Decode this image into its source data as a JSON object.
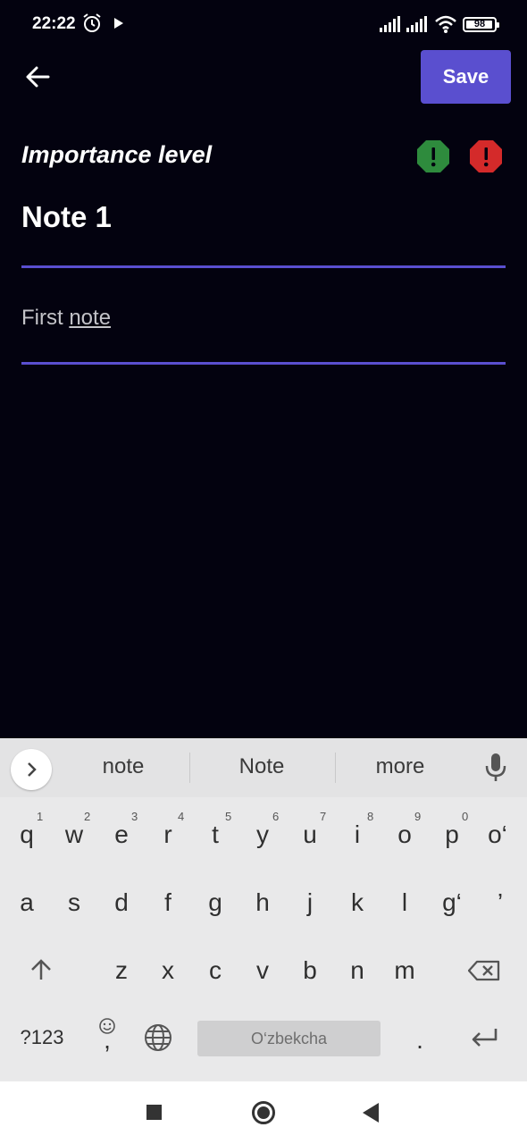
{
  "status_bar": {
    "time": "22:22",
    "battery_level": 98,
    "battery_text": "98",
    "icons": [
      "alarm-icon",
      "play-icon",
      "signal-icon",
      "signal-icon",
      "wifi-icon",
      "battery-icon"
    ]
  },
  "app_bar": {
    "back_icon": "arrow-left-icon",
    "save_label": "Save",
    "accent_color": "#5a4fcf"
  },
  "importance": {
    "label": "Importance level",
    "options": [
      {
        "icon": "exclamation-octagon-icon",
        "color": "#2e8b3d"
      },
      {
        "icon": "exclamation-octagon-icon",
        "color": "#d42a2a"
      }
    ]
  },
  "note": {
    "title": "Note 1",
    "body_prefix": "First ",
    "body_underlined": "note"
  },
  "keyboard": {
    "suggestions": [
      "note",
      "Note",
      "more"
    ],
    "row1": [
      "q",
      "w",
      "e",
      "r",
      "t",
      "y",
      "u",
      "i",
      "o",
      "p",
      "o‘"
    ],
    "row1_hints": [
      "1",
      "2",
      "3",
      "4",
      "5",
      "6",
      "7",
      "8",
      "9",
      "0"
    ],
    "row2": [
      "a",
      "s",
      "d",
      "f",
      "g",
      "h",
      "j",
      "k",
      "l",
      "g‘",
      "’"
    ],
    "row3": [
      "z",
      "x",
      "c",
      "v",
      "b",
      "n",
      "m"
    ],
    "symbols_label": "?123",
    "emoji_comma": ",",
    "space_label": "O‘zbekcha",
    "period": "."
  }
}
